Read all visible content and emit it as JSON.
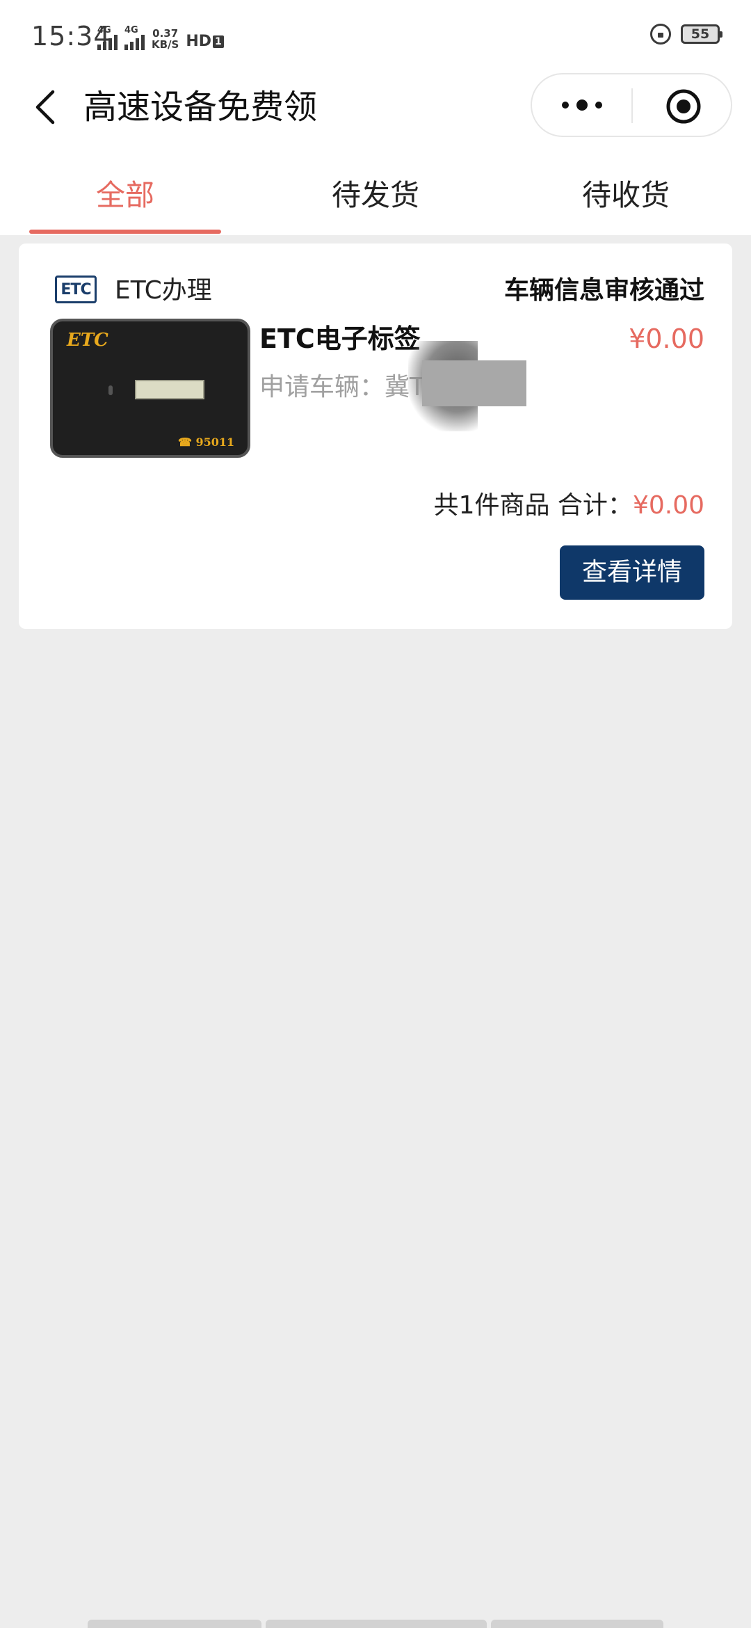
{
  "status_bar": {
    "time": "15:34",
    "net_type_1": "4G",
    "net_type_2": "4G",
    "speed_value": "0.37",
    "speed_unit": "KB/S",
    "hd_label": "HD",
    "hd_num": "1",
    "battery": "55"
  },
  "nav": {
    "title": "高速设备免费领"
  },
  "tabs": [
    {
      "label": "全部",
      "active": true
    },
    {
      "label": "待发货",
      "active": false
    },
    {
      "label": "待收货",
      "active": false
    }
  ],
  "order": {
    "shop_logo_text": "ETC",
    "shop_name": "ETC办理",
    "status": "车辆信息审核通过",
    "product": {
      "image_brand": "ETC",
      "image_phone": "☎ 95011",
      "name": "ETC电子标签",
      "price": "¥0.00",
      "vehicle_label": "申请车辆：",
      "vehicle_plate": "冀T2"
    },
    "summary_prefix": "共1件商品 合计：",
    "summary_total": "¥0.00",
    "detail_button": "查看详情"
  },
  "colors": {
    "accent": "#e66a60",
    "button": "#0f3869",
    "logo": "#1b3e6b",
    "background": "#ededed"
  }
}
